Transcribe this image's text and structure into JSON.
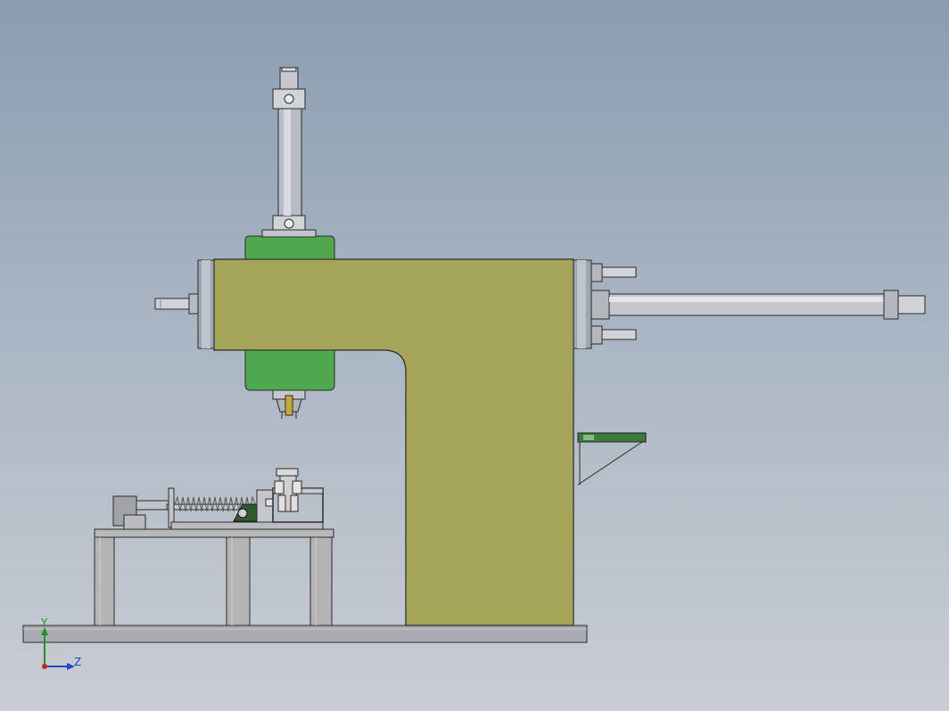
{
  "triad": {
    "y_label": "Y",
    "z_label": "Z"
  },
  "colors": {
    "frame": "#a5a55a",
    "head": "#4fa84f",
    "steel": "#b8bcc2",
    "steel_dark": "#7d8289",
    "table": "#b4b4b4",
    "base": "#a8acb2",
    "rail_green": "#3d7a3d",
    "axis_y": "#2a8f2a",
    "axis_z": "#2244cc",
    "axis_origin": "#cc2222"
  }
}
